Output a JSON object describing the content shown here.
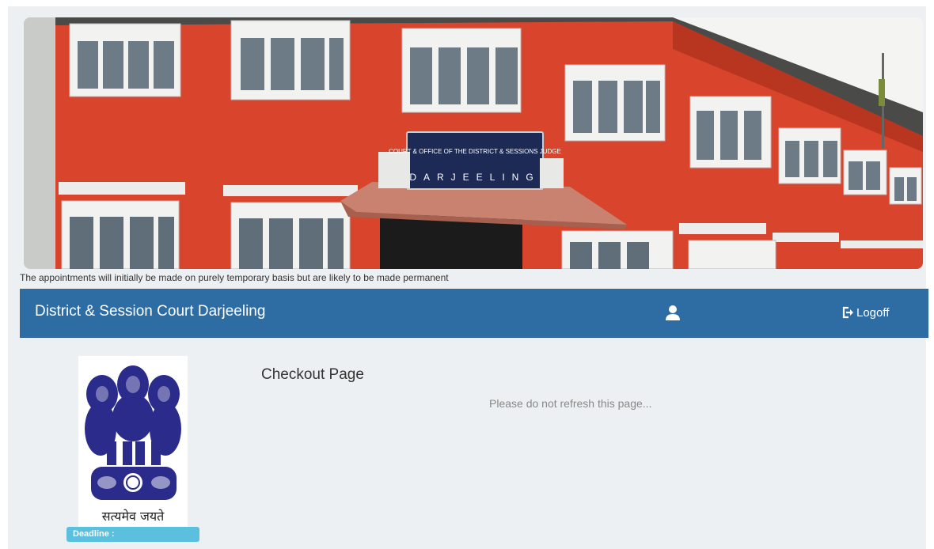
{
  "banner": {
    "sign_line1": "COURT & OFFICE OF THE DISTRICT & SESSIONS JUDGE",
    "sign_line2": "DARJEELING"
  },
  "notice": "The appointments will initially be made on purely temporary basis but are likely to be made permanent",
  "navbar": {
    "brand": "District & Session Court Darjeeling",
    "user_icon": "user-icon",
    "logoff_icon": "logout-icon",
    "logoff_label": "Logoff",
    "color": "#2e6da4"
  },
  "sidebar": {
    "emblem_motto": "सत्यमेव जयते",
    "deadline_label": "Deadline :"
  },
  "main": {
    "title": "Checkout Page",
    "message": "Please do not refresh this page..."
  }
}
